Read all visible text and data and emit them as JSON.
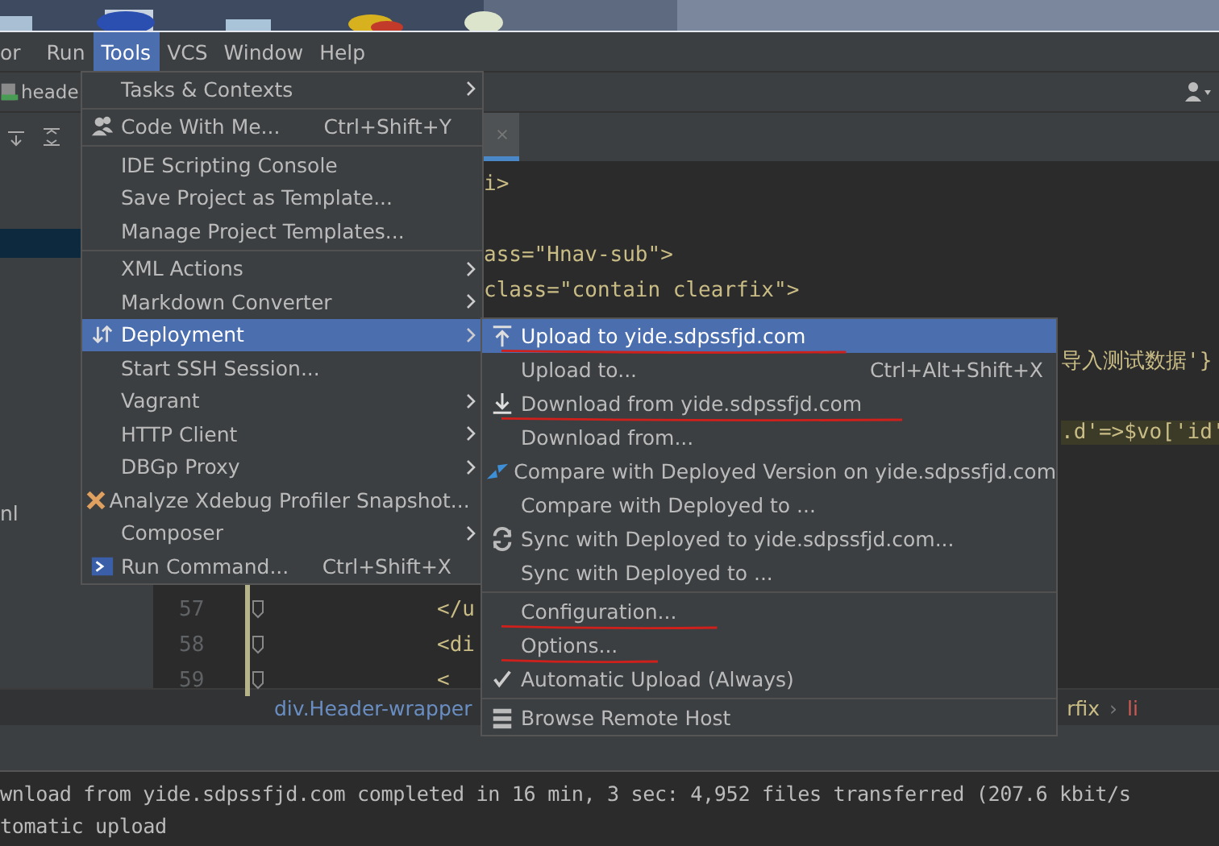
{
  "menu_bar": [
    {
      "label": "or",
      "selected": false
    },
    {
      "label": "Run",
      "selected": false
    },
    {
      "label": "Tools",
      "selected": true
    },
    {
      "label": "VCS",
      "selected": false
    },
    {
      "label": "Window",
      "selected": false
    },
    {
      "label": "Help",
      "selected": false
    }
  ],
  "toolbar": {
    "file_tab": "heade"
  },
  "editor": {
    "lines": [
      {
        "text": "i>"
      },
      {
        "text": "ass=\"Hnav-sub\">"
      },
      {
        "text": "class=\"contain clearfix\">"
      },
      {
        "text": "导入测试数据'}"
      },
      {
        "text": ".d'=>$vo['id'",
        "highlighted": true
      },
      {
        "number": "57",
        "text": "</u"
      },
      {
        "number": "58",
        "text": "<di"
      },
      {
        "number": "59",
        "text": "<"
      }
    ]
  },
  "project_panel": {
    "items": [
      {
        "selected": true
      },
      {
        "label": "nl",
        "selected": false
      }
    ]
  },
  "breadcrumb": {
    "left": "div.Header-wrapper",
    "right": [
      {
        "label": "rfix",
        "kind": "class"
      },
      {
        "label": "›",
        "kind": "sep"
      },
      {
        "label": "li",
        "kind": "tag"
      }
    ]
  },
  "tools_menu": [
    {
      "label": "Tasks & Contexts",
      "submenu": true
    },
    {
      "label": "Code With Me...",
      "shortcut": "Ctrl+Shift+Y",
      "kind": "people",
      "separator_before": true
    },
    {
      "label": "IDE Scripting Console",
      "separator_before": true
    },
    {
      "label": "Save Project as Template..."
    },
    {
      "label": "Manage Project Templates..."
    },
    {
      "label": "XML Actions",
      "submenu": true,
      "separator_before": true
    },
    {
      "label": "Markdown Converter",
      "submenu": true
    },
    {
      "label": "Deployment",
      "submenu": true,
      "kind": "deploy",
      "selected": true
    },
    {
      "label": "Start SSH Session..."
    },
    {
      "label": "Vagrant",
      "submenu": true
    },
    {
      "label": "HTTP Client",
      "submenu": true
    },
    {
      "label": "DBGp Proxy",
      "submenu": true
    },
    {
      "label": "Analyze Xdebug Profiler Snapshot...",
      "kind": "xdebug"
    },
    {
      "label": "Composer",
      "submenu": true
    },
    {
      "label": "Run Command...",
      "shortcut": "Ctrl+Shift+X",
      "kind": "terminal"
    }
  ],
  "deployment_menu": [
    {
      "label": "Upload to yide.sdpssfjd.com",
      "kind": "upload",
      "selected": true,
      "annotated": true
    },
    {
      "label": "Upload to...",
      "shortcut": "Ctrl+Alt+Shift+X"
    },
    {
      "label": "Download from yide.sdpssfjd.com",
      "kind": "download",
      "annotated": true
    },
    {
      "label": "Download from..."
    },
    {
      "label": "Compare with Deployed Version on yide.sdpssfjd.com",
      "kind": "compare"
    },
    {
      "label": "Compare with Deployed to ..."
    },
    {
      "label": "Sync with Deployed to yide.sdpssfjd.com...",
      "kind": "sync"
    },
    {
      "label": "Sync with Deployed to ..."
    },
    {
      "label": "Configuration...",
      "separator_before": true,
      "annotated": true
    },
    {
      "label": "Options...",
      "annotated": true
    },
    {
      "label": "Automatic Upload (Always)",
      "checked": true
    },
    {
      "label": "Browse Remote Host",
      "kind": "list",
      "separator_before": true
    }
  ],
  "console": [
    "wnload from yide.sdpssfjd.com completed in 16 min, 3 sec: 4,952 files transferred (207.6 kbit/s",
    "tomatic upload"
  ]
}
